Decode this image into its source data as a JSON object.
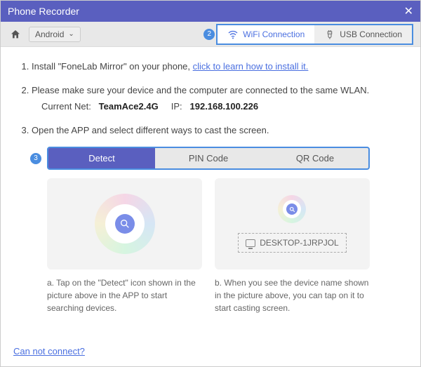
{
  "titlebar": {
    "title": "Phone Recorder"
  },
  "toolbar": {
    "os_selected": "Android",
    "connection": {
      "step_num": "2",
      "wifi_label": "WiFi Connection",
      "usb_label": "USB Connection"
    }
  },
  "steps": {
    "s1_prefix": "Install \"FoneLab Mirror\" on your phone, ",
    "s1_link": "click to learn how to install it.",
    "s2_text": "Please make sure your device and the computer are connected to the same WLAN.",
    "s2_net_label": "Current Net:",
    "s2_net_value": "TeamAce2.4G",
    "s2_ip_label": "IP:",
    "s2_ip_value": "192.168.100.226",
    "s3_text": "Open the APP and select different ways to cast the screen."
  },
  "cast_tabs": {
    "step_num": "3",
    "detect": "Detect",
    "pin": "PIN Code",
    "qr": "QR Code"
  },
  "device_name": "DESKTOP-1JRPJOL",
  "captions": {
    "a": "a. Tap on the \"Detect\" icon shown in the picture above in the APP to start searching devices.",
    "b": "b. When you see the device name shown in the picture above, you can tap on it to start casting screen."
  },
  "footer": {
    "cannot_connect": "Can not connect?"
  }
}
